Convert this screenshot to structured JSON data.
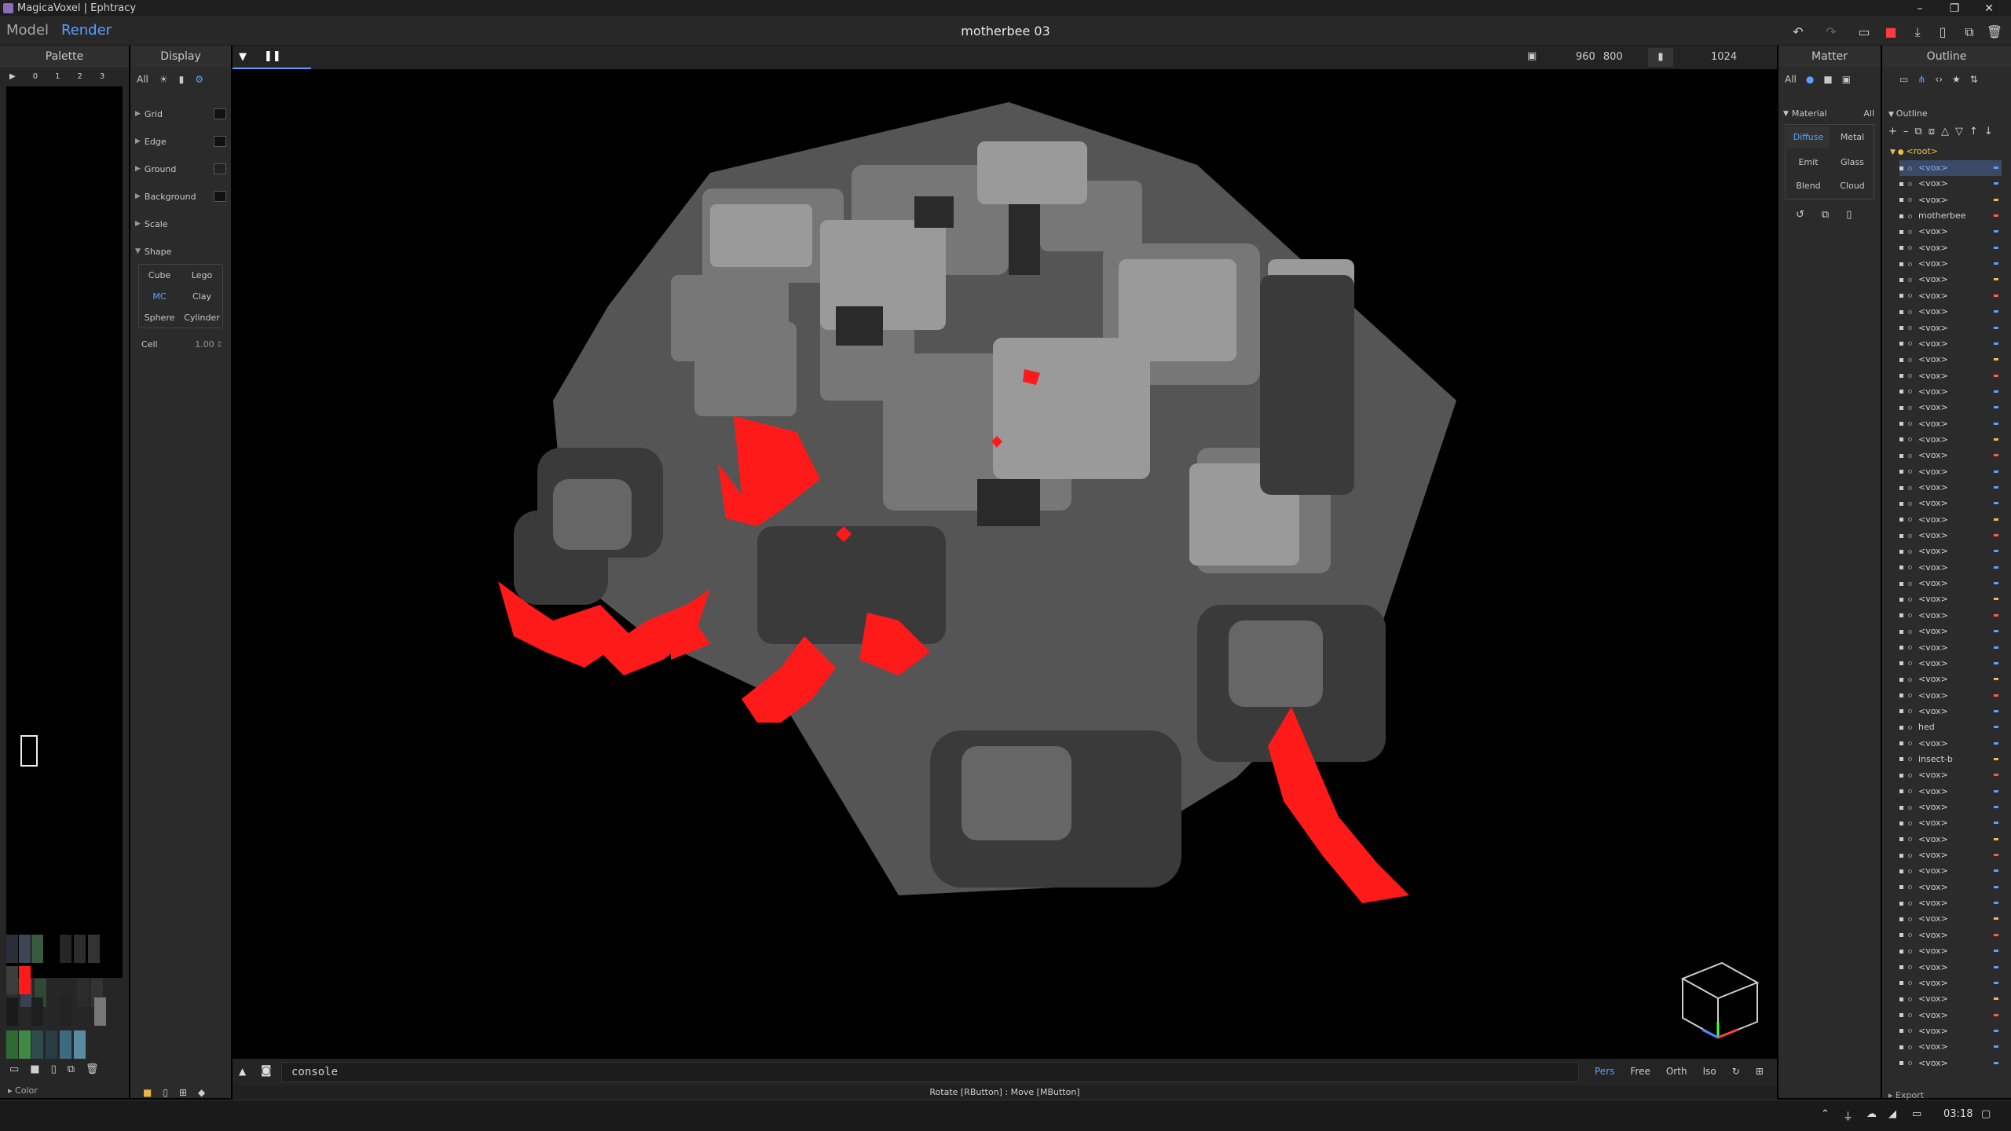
{
  "window": {
    "title": "MagicaVoxel | Ephtracy",
    "minimize": "–",
    "restore": "❐",
    "close": "✕"
  },
  "menu": {
    "modes": [
      "Model",
      "Render"
    ],
    "active_mode": "Render",
    "document_title": "motherbee 03"
  },
  "palette": {
    "header": "Palette",
    "pages": [
      "▶",
      "0",
      "1",
      "2",
      "3"
    ],
    "footer_label": "Color"
  },
  "display": {
    "header": "Display",
    "filter_all": "All",
    "rows": [
      "Grid",
      "Edge",
      "Ground",
      "Background",
      "Scale",
      "Shape"
    ],
    "shapes": [
      "Cube",
      "Lego",
      "MC",
      "Clay",
      "Sphere",
      "Cylinder"
    ],
    "active_shape": "MC",
    "cell_label": "Cell",
    "cell_value": "1.00"
  },
  "viewport": {
    "size_w": "960",
    "size_h": "800",
    "samples": "1024",
    "console_text": "console",
    "camera_modes": [
      "Pers",
      "Free",
      "Orth",
      "Iso"
    ],
    "active_camera": "Pers",
    "status_hint": "Rotate [RButton] : Move [MButton]"
  },
  "matter": {
    "header": "Matter",
    "filter_all": "All",
    "material_label": "Material",
    "material_all": "All",
    "types": [
      "Diffuse",
      "Metal",
      "Emit",
      "Glass",
      "Blend",
      "Cloud"
    ],
    "active_type": "Diffuse"
  },
  "outline": {
    "header": "Outline",
    "section_label": "Outline",
    "root": "<root>",
    "items": [
      "<vox>",
      "<vox>",
      "<vox>",
      "motherbee",
      "<vox>",
      "<vox>",
      "<vox>",
      "<vox>",
      "<vox>",
      "<vox>",
      "<vox>",
      "<vox>",
      "<vox>",
      "<vox>",
      "<vox>",
      "<vox>",
      "<vox>",
      "<vox>",
      "<vox>",
      "<vox>",
      "<vox>",
      "<vox>",
      "<vox>",
      "<vox>",
      "<vox>",
      "<vox>",
      "<vox>",
      "<vox>",
      "<vox>",
      "<vox>",
      "<vox>",
      "<vox>",
      "<vox>",
      "<vox>",
      "<vox>",
      "hed",
      "<vox>",
      "insect-b",
      "<vox>",
      "<vox>",
      "<vox>",
      "<vox>",
      "<vox>",
      "<vox>",
      "<vox>",
      "<vox>",
      "<vox>",
      "<vox>",
      "<vox>",
      "<vox>",
      "<vox>",
      "<vox>",
      "<vox>",
      "<vox>",
      "<vox>",
      "<vox>",
      "<vox>"
    ],
    "export_label": "Export"
  },
  "taskbar": {
    "clock": "03:18"
  },
  "colors": {
    "accent": "#5aa0ff",
    "red": "#ff1a1a",
    "selected_item": "#4f86d8",
    "root_label": "#e8c24a"
  }
}
